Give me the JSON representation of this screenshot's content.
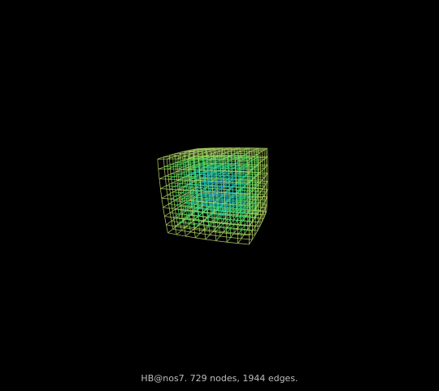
{
  "graph": {
    "caption": "HB@nos7. 729 nodes, 1944 edges.",
    "nodes": 729,
    "edges": 1944,
    "grid": [
      9,
      9,
      9
    ],
    "background": "#000000",
    "palette": {
      "center": "#1e5cff",
      "mid": "#19c8b4",
      "outer": "#55e04a",
      "edge_rim": "#b8d86a"
    }
  }
}
